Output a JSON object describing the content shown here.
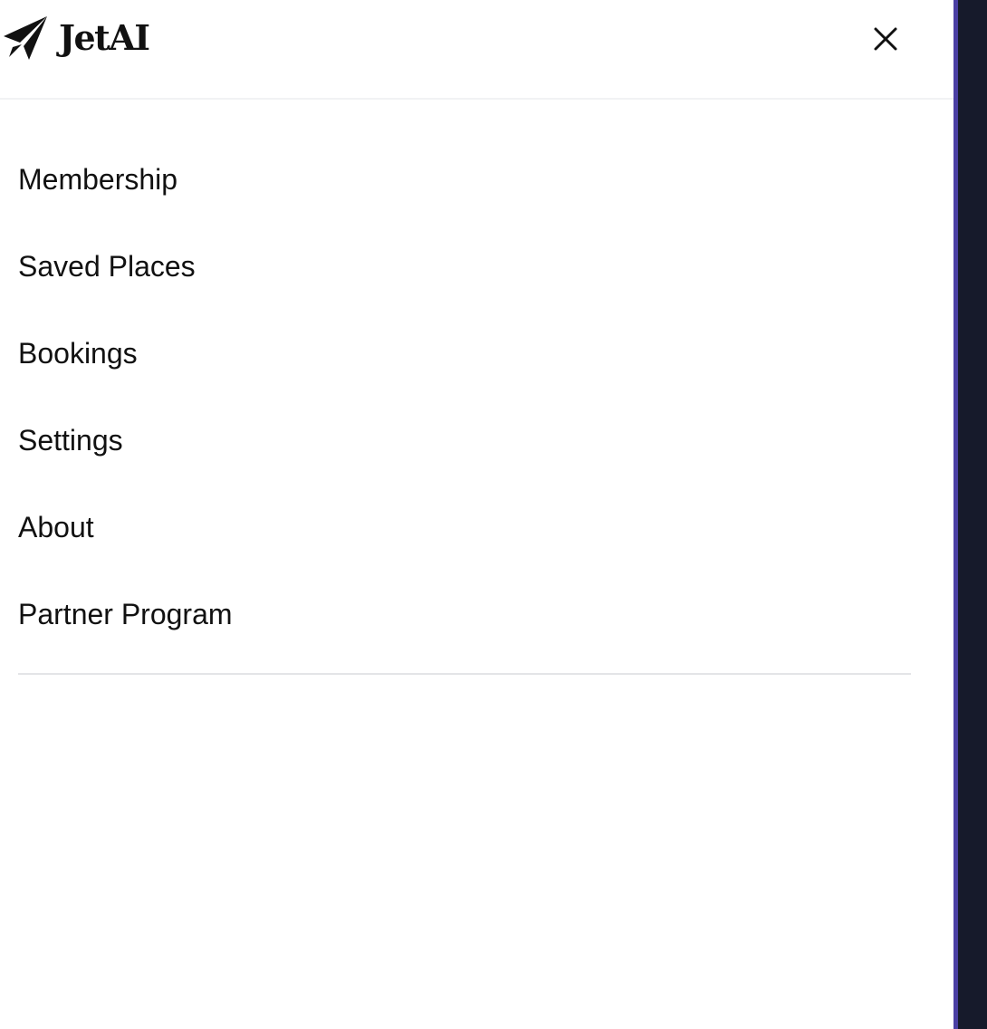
{
  "app": {
    "name": "JetAI",
    "logo_icon": "paper-plane-icon"
  },
  "header": {
    "close_icon": "close-icon"
  },
  "menu": {
    "items": [
      {
        "label": "Membership"
      },
      {
        "label": "Saved Places"
      },
      {
        "label": "Bookings"
      },
      {
        "label": "Settings"
      },
      {
        "label": "About"
      },
      {
        "label": "Partner Program"
      }
    ]
  },
  "colors": {
    "text": "#111111",
    "drawer_background": "#ffffff",
    "backdrop": "#161a2b",
    "backdrop_accent": "#4a3fa3",
    "divider": "#e3e4e7"
  }
}
